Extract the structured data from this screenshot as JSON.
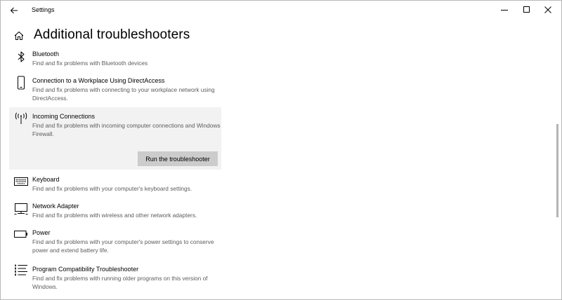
{
  "window": {
    "app_title": "Settings",
    "icons": {
      "back": "back-arrow-icon",
      "minimize": "minimize-icon",
      "maximize": "maximize-icon",
      "close": "close-icon"
    }
  },
  "header": {
    "title": "Additional troubleshooters",
    "icon": "home-icon"
  },
  "troubleshooters": [
    {
      "title": "Bluetooth",
      "description": "Find and fix problems with Bluetooth devices",
      "icon": "bluetooth-icon"
    },
    {
      "title": "Connection to a Workplace Using DirectAccess",
      "description": "Find and fix problems with connecting to your workplace network using DirectAccess.",
      "icon": "phone-icon"
    },
    {
      "title": "Incoming Connections",
      "description": "Find and fix problems with incoming computer connections and Windows Firewall.",
      "icon": "antenna-icon",
      "selected": true,
      "action_label": "Run the troubleshooter"
    },
    {
      "title": "Keyboard",
      "description": "Find and fix problems with your computer's keyboard settings.",
      "icon": "keyboard-icon"
    },
    {
      "title": "Network Adapter",
      "description": "Find and fix problems with wireless and other network adapters.",
      "icon": "monitor-icon"
    },
    {
      "title": "Power",
      "description": "Find and fix problems with your computer's power settings to conserve power and extend battery life.",
      "icon": "battery-icon"
    },
    {
      "title": "Program Compatibility Troubleshooter",
      "description": "Find and fix problems with running older programs on this version of Windows.",
      "icon": "list-icon"
    }
  ],
  "colors": {
    "selected_background": "#f2f2f2",
    "button_background": "#cccccc",
    "description_text": "#5c5c5c"
  }
}
